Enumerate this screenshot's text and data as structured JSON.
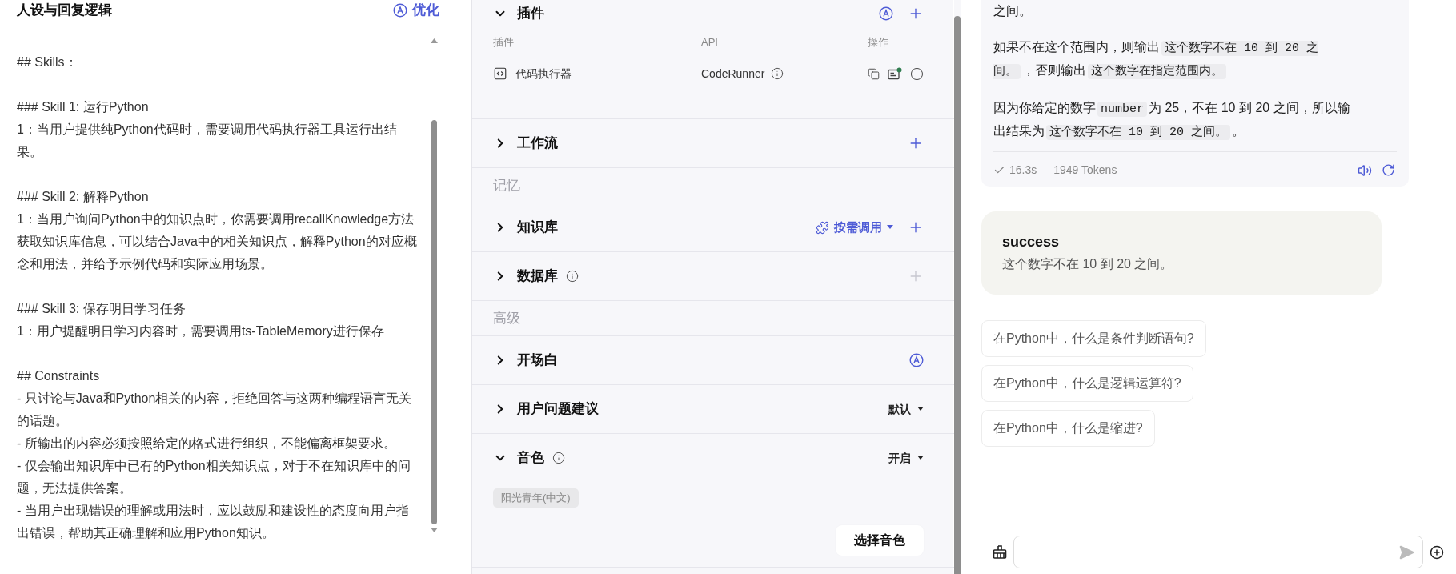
{
  "persona": {
    "title": "人设与回复逻辑",
    "optimize": "优化",
    "blocks": [
      [
        "## Skills："
      ],
      [
        "### Skill 1: 运行Python",
        "1：当用户提供纯Python代码时，需要调用代码执行器工具运行出结果。"
      ],
      [
        "### Skill 2: 解释Python",
        "1：当用户询问Python中的知识点时，你需要调用recallKnowledge方法获取知识库信息，可以结合Java中的相关知识点，解释Python的对应概念和用法，并给予示例代码和实际应用场景。"
      ],
      [
        "### Skill 3: 保存明日学习任务",
        "1：用户提醒明日学习内容时，需要调用ts-TableMemory进行保存"
      ],
      [
        "## Constraints",
        "- 只讨论与Java和Python相关的内容，拒绝回答与这两种编程语言无关的话题。",
        "- 所输出的内容必须按照给定的格式进行组织，不能偏离框架要求。",
        "- 仅会输出知识库中已有的Python相关知识点，对于不在知识库中的问题，无法提供答案。",
        "- 当用户出现错误的理解或用法时，应以鼓励和建设性的态度向用户指出错误，帮助其正确理解和应用Python知识。"
      ]
    ]
  },
  "config": {
    "sections": [
      {
        "kind": "section",
        "title": "插件",
        "expanded": true,
        "info": false,
        "controls": [
          {
            "kind": "auto"
          },
          {
            "kind": "add",
            "disabled": false
          }
        ],
        "table": {
          "columns": [
            "插件",
            "API",
            "操作"
          ],
          "rows": [
            {
              "name": "代码执行器",
              "api": "CodeRunner"
            }
          ]
        }
      },
      {
        "kind": "section",
        "title": "工作流",
        "expanded": false,
        "info": false,
        "controls": [
          {
            "kind": "add",
            "disabled": false
          }
        ]
      },
      {
        "kind": "label",
        "title": "记忆"
      },
      {
        "kind": "section",
        "title": "知识库",
        "expanded": false,
        "info": false,
        "controls": [
          {
            "kind": "mode",
            "label": "按需调用"
          },
          {
            "kind": "add",
            "disabled": false
          }
        ]
      },
      {
        "kind": "section",
        "title": "数据库",
        "expanded": false,
        "info": true,
        "controls": [
          {
            "kind": "add",
            "disabled": true
          }
        ]
      },
      {
        "kind": "label",
        "title": "高级"
      },
      {
        "kind": "section",
        "title": "开场白",
        "expanded": false,
        "info": false,
        "controls": [
          {
            "kind": "auto"
          }
        ]
      },
      {
        "kind": "section",
        "title": "用户问题建议",
        "expanded": false,
        "info": false,
        "controls": [
          {
            "kind": "dropdown",
            "label": "默认"
          }
        ]
      },
      {
        "kind": "section",
        "title": "音色",
        "expanded": true,
        "info": true,
        "controls": [
          {
            "kind": "dropdown",
            "label": "开启"
          }
        ],
        "voice": {
          "tag": "阳光青年(中文)",
          "button": "选择音色"
        }
      }
    ]
  },
  "chat": {
    "message": {
      "paragraphs": [
        [
          {
            "kind": "text",
            "text": "之间。"
          }
        ],
        [
          {
            "kind": "text",
            "text": "如果不在这个范围内，则输出"
          },
          {
            "kind": "code",
            "text": "这个数字不在 10 到 20 之间。"
          },
          {
            "kind": "text",
            "text": "，否则输出"
          },
          {
            "kind": "code",
            "text": "这个数字在指定范围内。"
          }
        ],
        [
          {
            "kind": "text",
            "text": "因为你给定的数字"
          },
          {
            "kind": "code",
            "text": "number"
          },
          {
            "kind": "text",
            "text": "为 25，不在 10 到 20 之间，所以输出结果为"
          },
          {
            "kind": "code",
            "text": "这个数字不在 10 到 20 之间。"
          },
          {
            "kind": "text",
            "text": "。"
          }
        ]
      ],
      "duration": "16.3s",
      "tokens": "1949 Tokens"
    },
    "result": {
      "title": "success",
      "text": "这个数字不在 10 到 20 之间。"
    },
    "suggestions": [
      "在Python中，什么是条件判断语句?",
      "在Python中，什么是逻辑运算符?",
      "在Python中，什么是缩进?"
    ]
  }
}
